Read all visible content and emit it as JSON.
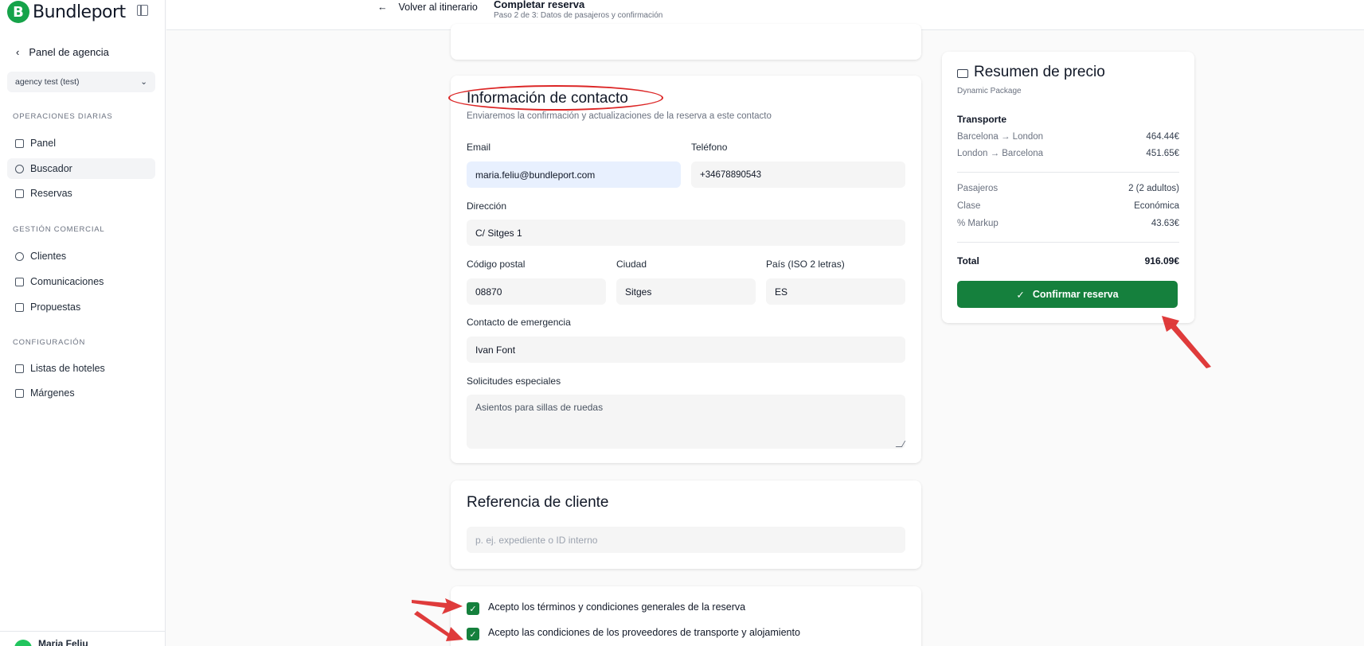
{
  "brand": {
    "name": "Bundleport",
    "mark": "B"
  },
  "sidebar": {
    "back_label": "Panel de agencia",
    "agency": "agency test (test)",
    "sections": [
      {
        "title": "OPERACIONES DIARIAS",
        "items": [
          {
            "label": "Panel"
          },
          {
            "label": "Buscador"
          },
          {
            "label": "Reservas"
          }
        ]
      },
      {
        "title": "GESTIÓN COMERCIAL",
        "items": [
          {
            "label": "Clientes"
          },
          {
            "label": "Comunicaciones"
          },
          {
            "label": "Propuestas"
          }
        ]
      },
      {
        "title": "CONFIGURACIÓN",
        "items": [
          {
            "label": "Listas de hoteles"
          },
          {
            "label": "Márgenes"
          }
        ]
      }
    ],
    "user": "Maria Feliu"
  },
  "topbar": {
    "back_label": "Volver al itinerario",
    "title": "Completar reserva",
    "subtitle": "Paso 2 de 3: Datos de pasajeros y confirmación"
  },
  "contact": {
    "title": "Información de contacto",
    "subtitle": "Enviaremos la confirmación y actualizaciones de la reserva a este contacto",
    "email_label": "Email",
    "email": "maria.feliu@bundleport.com",
    "phone_label": "Teléfono",
    "phone": "+34678890543",
    "address_label": "Dirección",
    "address": "C/ Sitges 1",
    "postal_label": "Código postal",
    "postal": "08870",
    "city_label": "Ciudad",
    "city": "Sitges",
    "country_label": "País (ISO 2 letras)",
    "country": "ES",
    "emergency_label": "Contacto de emergencia",
    "emergency": "Ivan Font",
    "requests_label": "Solicitudes especiales",
    "requests": "Asientos para sillas de ruedas"
  },
  "reference": {
    "title": "Referencia de cliente",
    "placeholder": "p. ej. expediente o ID interno"
  },
  "terms": {
    "general": "Acepto los términos y condiciones generales de la reserva",
    "providers": "Acepto las condiciones de los proveedores de transporte y alojamiento"
  },
  "summary": {
    "title": "Resumen de precio",
    "subtitle": "Dynamic Package",
    "transport_label": "Transporte",
    "legs": [
      {
        "route": "Barcelona → London",
        "price": "464.44€"
      },
      {
        "route": "London → Barcelona",
        "price": "451.65€"
      }
    ],
    "passengers_label": "Pasajeros",
    "passengers": "2 (2 adultos)",
    "class_label": "Clase",
    "class": "Económica",
    "markup_label": "% Markup",
    "markup": "43.63€",
    "total_label": "Total",
    "total": "916.09€",
    "confirm_label": "Confirmar reserva"
  },
  "colors": {
    "accent": "#15803d",
    "annotation": "#dc2626"
  }
}
